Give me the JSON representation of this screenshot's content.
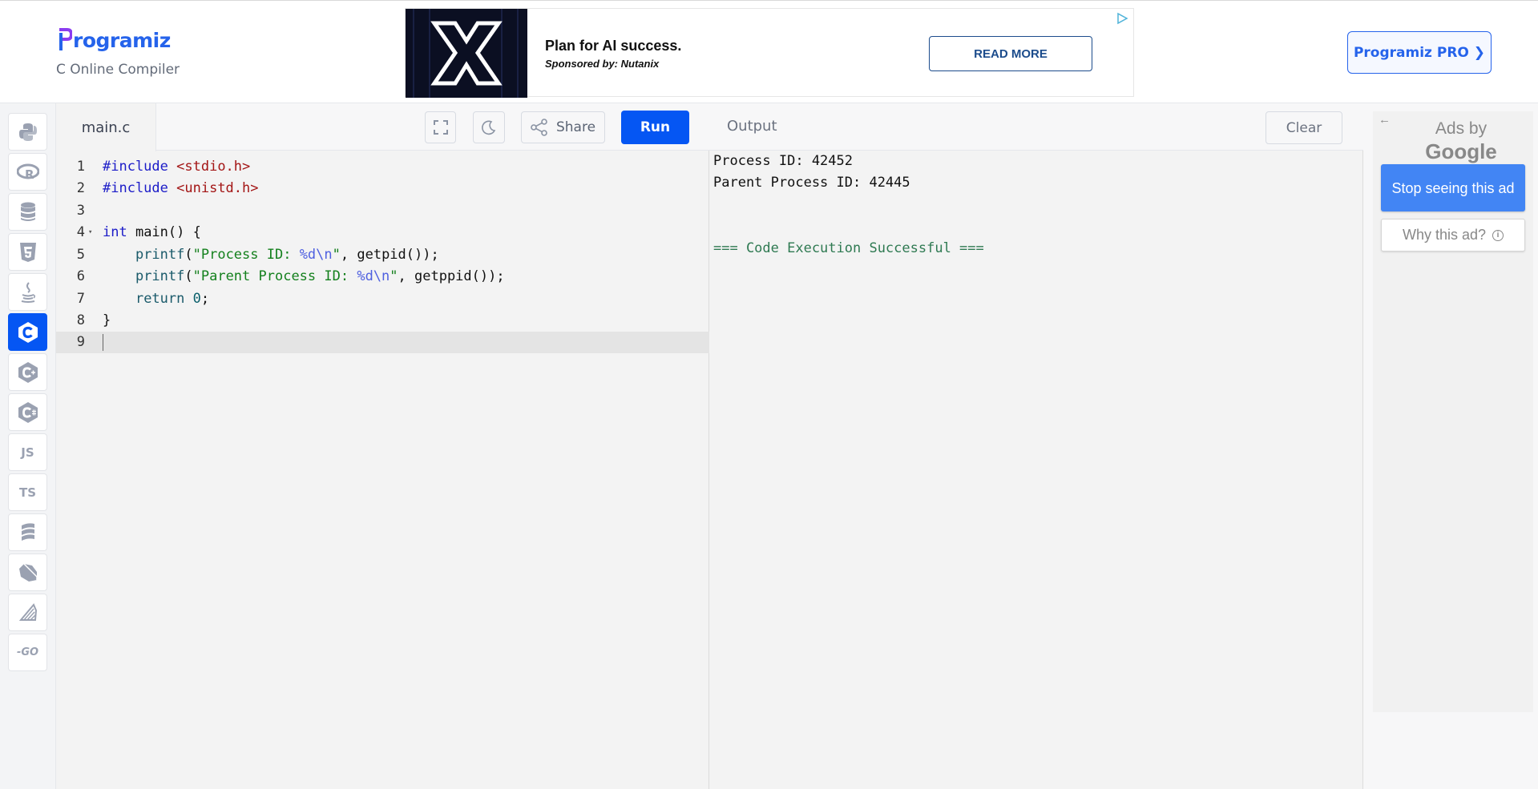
{
  "header": {
    "logo_text": "rogramiz",
    "logo_initial": "P",
    "subtitle": "C Online Compiler",
    "pro_button": "Programiz PRO ❯"
  },
  "ad_banner": {
    "title": "Plan for AI success.",
    "sponsor": "Sponsored by: Nutanix",
    "cta": "READ MORE"
  },
  "sidebar": {
    "languages": [
      {
        "name": "python",
        "icon": "python-icon"
      },
      {
        "name": "r",
        "icon": "r-icon"
      },
      {
        "name": "sql",
        "icon": "database-icon"
      },
      {
        "name": "html",
        "icon": "html5-icon"
      },
      {
        "name": "java",
        "icon": "java-icon"
      },
      {
        "name": "c",
        "icon": "c-icon",
        "active": true
      },
      {
        "name": "cpp",
        "icon": "cpp-icon"
      },
      {
        "name": "csharp",
        "icon": "csharp-icon"
      },
      {
        "name": "javascript",
        "icon": "js-icon",
        "label": "JS"
      },
      {
        "name": "typescript",
        "icon": "ts-icon",
        "label": "TS"
      },
      {
        "name": "scala",
        "icon": "scala-icon"
      },
      {
        "name": "dart",
        "icon": "dart-icon"
      },
      {
        "name": "rust",
        "icon": "rust-icon"
      },
      {
        "name": "go",
        "icon": "go-icon",
        "label": "GO"
      }
    ]
  },
  "editor": {
    "file_tab": "main.c",
    "share_label": "Share",
    "run_label": "Run",
    "lines": [
      "1",
      "2",
      "3",
      "4",
      "5",
      "6",
      "7",
      "8",
      "9"
    ]
  },
  "output": {
    "title": "Output",
    "clear_label": "Clear",
    "lines": [
      "Process ID: 42452",
      "Parent Process ID: 42445",
      "=== Code Execution Successful ==="
    ]
  },
  "side_ad": {
    "back": "←",
    "ads_by": "Ads by",
    "google": "Google",
    "stop": "Stop seeing this ad",
    "why": "Why this ad?"
  },
  "colors": {
    "brand": "#0556f3",
    "success": "#2f7a52"
  }
}
